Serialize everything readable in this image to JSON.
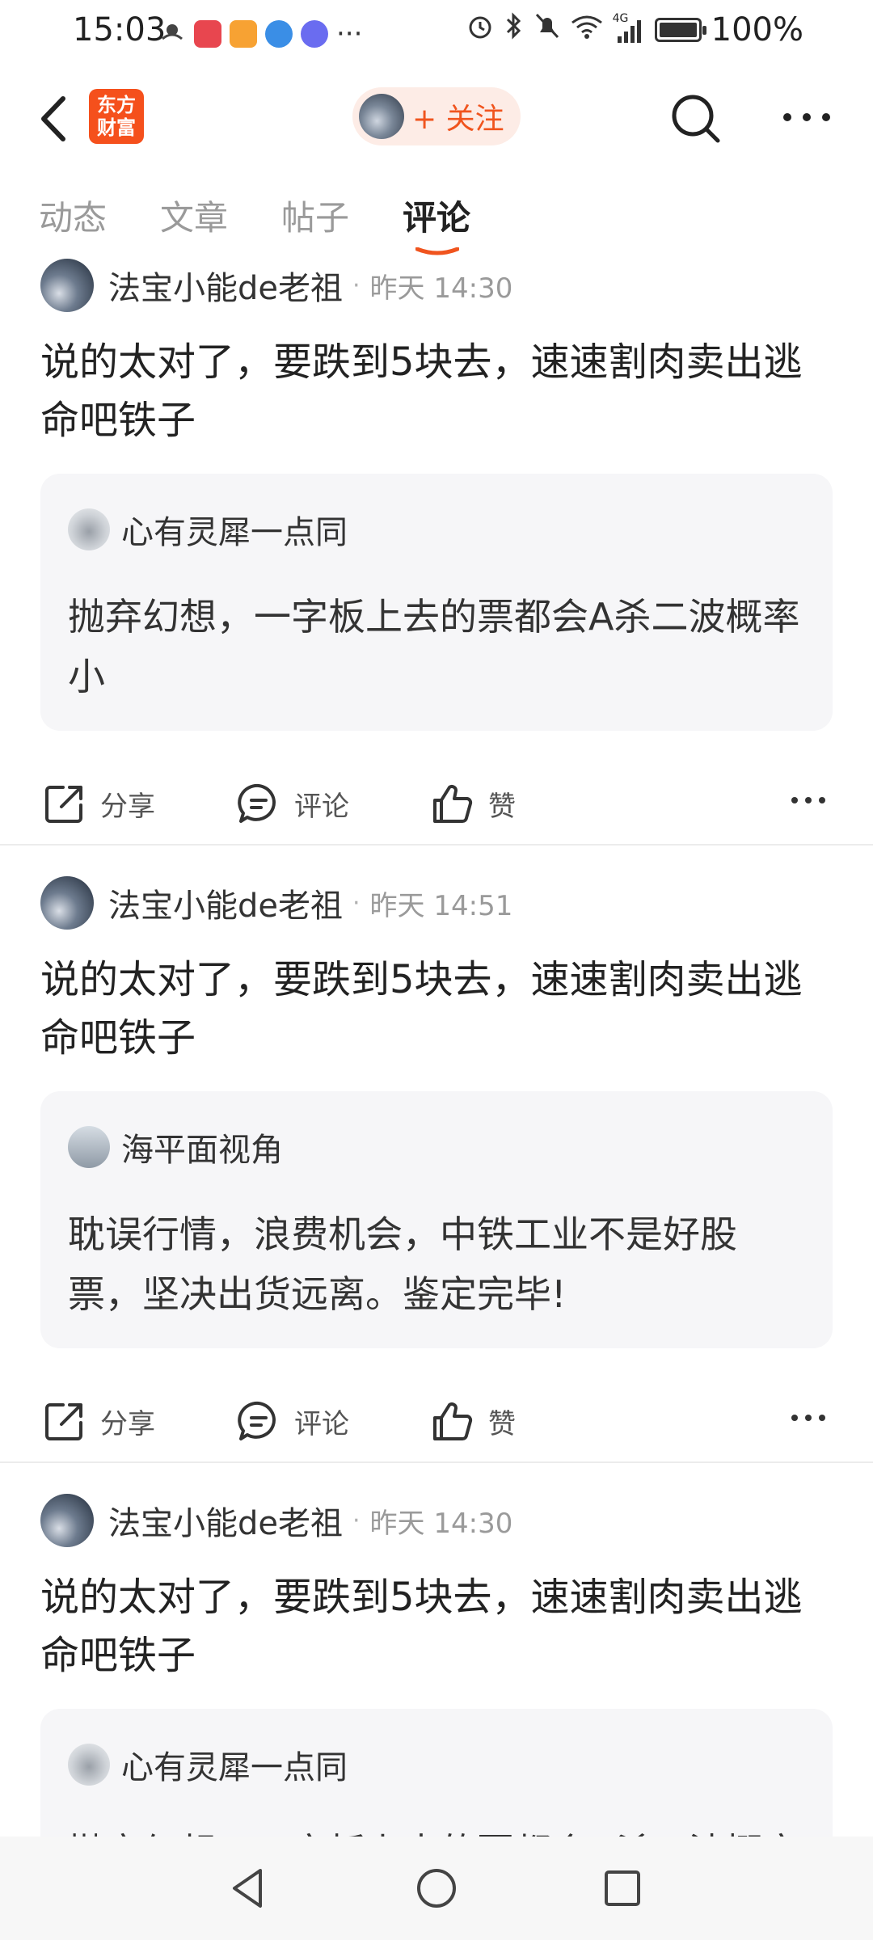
{
  "status_bar": {
    "time": "15:03",
    "more_glyph": "···",
    "network": "4G",
    "battery_percent": "100%",
    "battery_level": 1.0
  },
  "header": {
    "logo_line1": "东方",
    "logo_line2": "财富",
    "follow_label": "+ 关注"
  },
  "tabs": [
    {
      "label": "动态",
      "active": false
    },
    {
      "label": "文章",
      "active": false
    },
    {
      "label": "帖子",
      "active": false
    },
    {
      "label": "评论",
      "active": true
    }
  ],
  "posts": [
    {
      "author": "法宝小能de老祖",
      "time": "昨天 14:30",
      "text": "说的太对了，要跌到5块去，速速割肉卖出逃命吧铁子",
      "quote_author": "心有灵犀一点同",
      "quote_text": "抛弃幻想，一字板上去的票都会A杀二波概率小"
    },
    {
      "author": "法宝小能de老祖",
      "time": "昨天 14:51",
      "text": "说的太对了，要跌到5块去，速速割肉卖出逃命吧铁子",
      "quote_author": "海平面视角",
      "quote_text": "耽误行情，浪费机会，中铁工业不是好股票，坚决出货远离。鉴定完毕!"
    },
    {
      "author": "法宝小能de老祖",
      "time": "昨天 14:30",
      "text": "说的太对了，要跌到5块去，速速割肉卖出逃命吧铁子",
      "quote_author": "心有灵犀一点同",
      "quote_text": "抛弃幻想，一字板上去的票都会A杀二波概率小"
    }
  ],
  "actions": {
    "share": "分享",
    "comment": "评论",
    "like": "赞"
  },
  "colors": {
    "accent": "#f0541e",
    "logo": "#f5501c",
    "quote_bg": "#f6f6f8"
  }
}
